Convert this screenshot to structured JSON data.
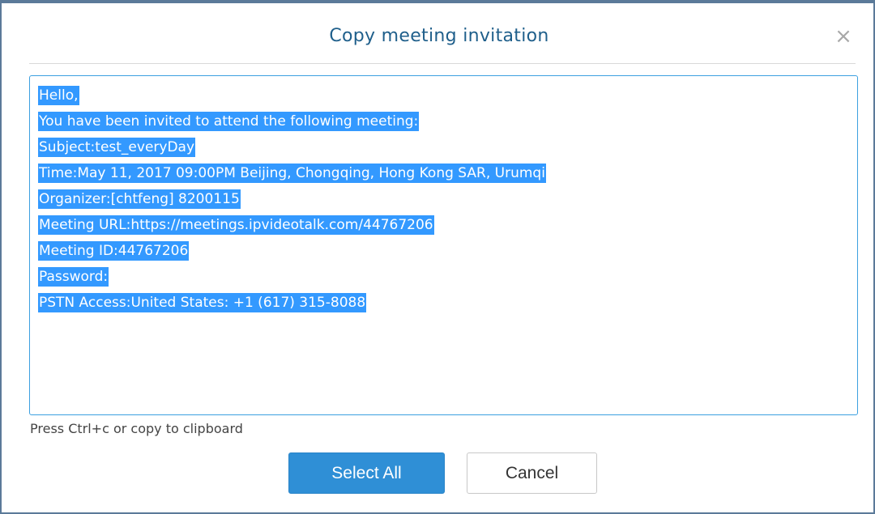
{
  "dialog": {
    "title": "Copy meeting invitation",
    "close_glyph": "×",
    "close_icon": "close-icon"
  },
  "invitation": {
    "lines": [
      "Hello,",
      "You have been invited to attend the following meeting:",
      "Subject:test_everyDay",
      "Time:May 11, 2017 09:00PM Beijing, Chongqing, Hong Kong SAR, Urumqi",
      "Organizer:[chtfeng] 8200115",
      "Meeting URL:https://meetings.ipvideotalk.com/44767206",
      "Meeting ID:44767206",
      "Password:",
      "PSTN Access:United States: +1 (617) 315-8088"
    ],
    "selected": true
  },
  "hint": "Press Ctrl+c or copy to clipboard",
  "buttons": {
    "select_all": "Select All",
    "cancel": "Cancel"
  },
  "colors": {
    "title": "#1f5f8b",
    "selection": "#3399ff",
    "primary_button": "#2f8fd6",
    "textarea_border": "#3ca0e0"
  }
}
